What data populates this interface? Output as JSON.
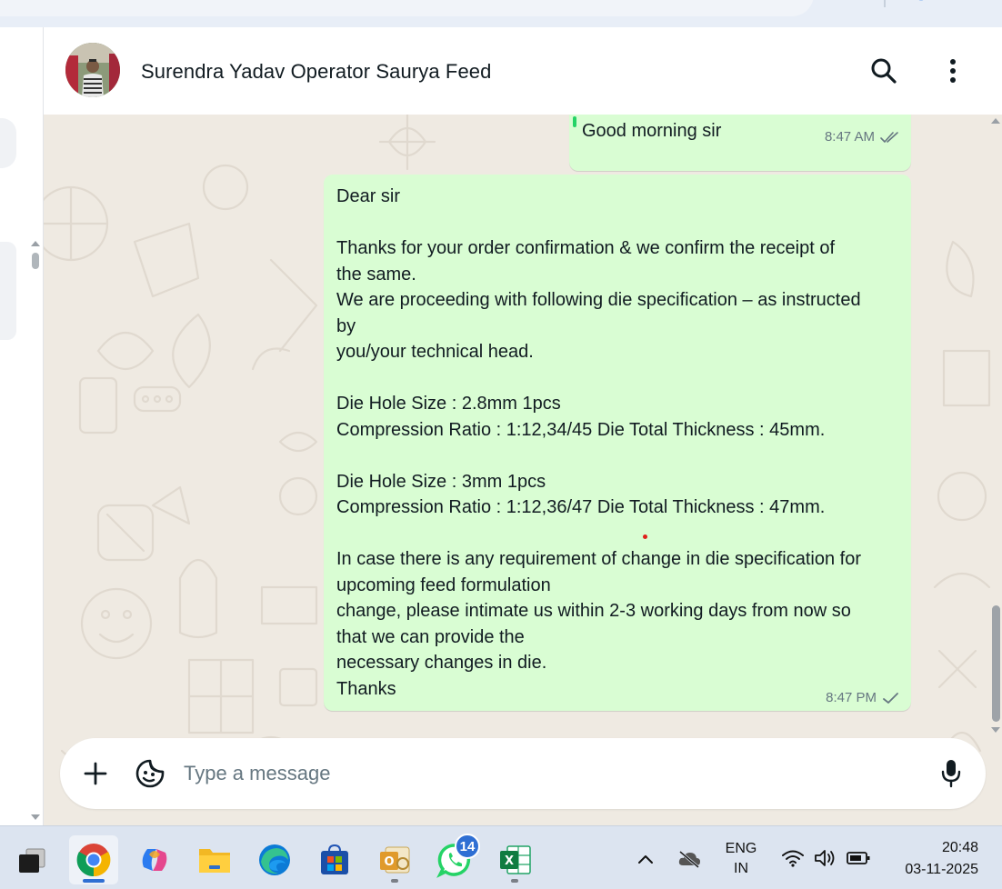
{
  "chat": {
    "contact_name": "Surendra Yadav Operator Saurya Feed"
  },
  "messages": [
    {
      "text": "Good morning sir",
      "time": "8:47 AM",
      "status": "read"
    },
    {
      "lines": [
        "Dear  sir",
        "",
        "Thanks for your order confirmation & we confirm the receipt of",
        "the same.",
        "We are proceeding with following die specification – as instructed",
        "by",
        "you/your technical head.",
        "",
        "Die Hole Size : 2.8mm 1pcs",
        "Compression Ratio : 1:12,34/45 Die Total Thickness : 45mm.",
        "",
        "Die Hole Size : 3mm 1pcs",
        "Compression Ratio : 1:12,36/47 Die Total Thickness : 47mm.",
        "",
        "In case there is any requirement of change in die specification for",
        "upcoming feed formulation",
        "change, please intimate us within 2-3 working days from now so",
        "that we can provide the",
        "necessary changes in die.",
        "Thanks"
      ],
      "time": "8:47 PM",
      "status": "sent"
    }
  ],
  "composer": {
    "placeholder": "Type a message"
  },
  "taskbar": {
    "apps": [
      "task-view",
      "chrome",
      "copilot",
      "file-explorer",
      "edge",
      "microsoft-store",
      "outlook",
      "whatsapp",
      "excel"
    ],
    "whatsapp_badge": "14",
    "language_line1": "ENG",
    "language_line2": "IN",
    "time": "20:48",
    "date": "03-11-2025"
  },
  "colors": {
    "outgoing_bubble": "#d9fdd3",
    "chat_background": "#efeae2",
    "read_tick": "#53bdeb",
    "badge": "#2f6fd3"
  }
}
